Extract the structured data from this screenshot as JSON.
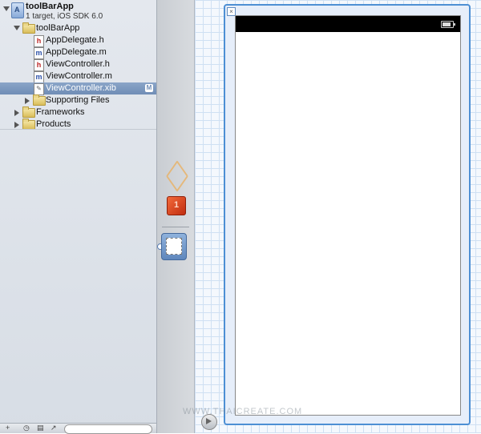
{
  "project": {
    "name": "toolBarApp",
    "subtitle": "1 target, iOS SDK 6.0"
  },
  "navigator": {
    "items": [
      {
        "label": "toolBarApp",
        "kind": "folder"
      },
      {
        "label": "AppDelegate.h",
        "kind": "h",
        "icon_text": "h"
      },
      {
        "label": "AppDelegate.m",
        "kind": "m",
        "icon_text": "m"
      },
      {
        "label": "ViewController.h",
        "kind": "h",
        "icon_text": "h"
      },
      {
        "label": "ViewController.m",
        "kind": "m",
        "icon_text": "m"
      },
      {
        "label": "ViewController.xib",
        "kind": "xib",
        "icon_text": "✎",
        "badge": "M",
        "selected": true
      },
      {
        "label": "Supporting Files",
        "kind": "folder"
      },
      {
        "label": "Frameworks",
        "kind": "folder"
      },
      {
        "label": "Products",
        "kind": "folder"
      }
    ]
  },
  "footer": {
    "add_glyph": "+",
    "clock_glyph": "◷",
    "doc_glyph": "▤",
    "edit_glyph": "↗"
  },
  "canvas": {
    "close_glyph": "×",
    "watermark": "WWW.THAICREATE.COM"
  },
  "colors": {
    "selection": "#7a96bf",
    "view_border": "#4d8fd4",
    "status_bar": "#000000"
  }
}
